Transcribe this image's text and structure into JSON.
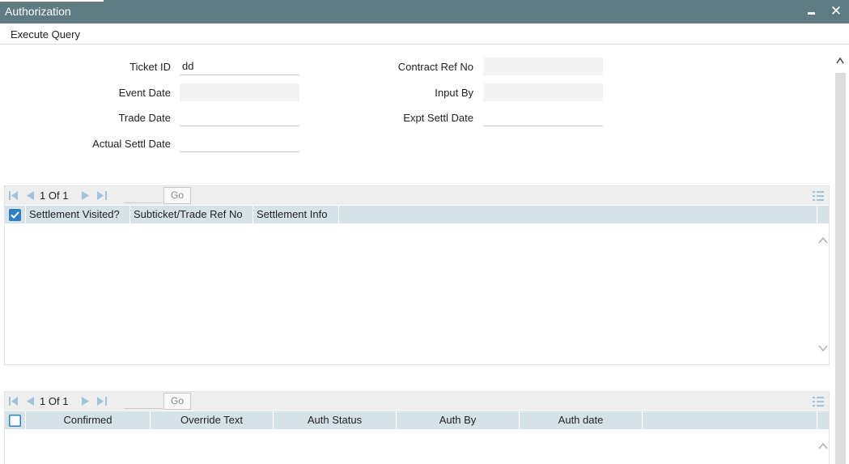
{
  "window": {
    "title": "Authorization",
    "minimize_icon": "minimize-icon",
    "close_icon": "close-icon",
    "title_bar_color": "#5f7c82"
  },
  "toolbar": {
    "execute_query_label": "Execute Query"
  },
  "form": {
    "ticket_id": {
      "label": "Ticket ID",
      "value": "dd"
    },
    "event_date": {
      "label": "Event Date",
      "value": ""
    },
    "trade_date": {
      "label": "Trade Date",
      "value": ""
    },
    "actual_settl_date": {
      "label": "Actual Settl Date",
      "value": ""
    },
    "contract_ref_no": {
      "label": "Contract Ref No",
      "value": ""
    },
    "input_by": {
      "label": "Input By",
      "value": ""
    },
    "expt_settl_date": {
      "label": "Expt Settl Date",
      "value": ""
    }
  },
  "settlement_grid": {
    "page_current": "1",
    "page_of": "Of",
    "page_total": "1",
    "go_label": "Go",
    "header_checkbox_checked": true,
    "columns": [
      "Settlement Visited?",
      "Subticket/Trade Ref No",
      "Settlement Info"
    ],
    "rows": []
  },
  "override_grid": {
    "page_current": "1",
    "page_of": "Of",
    "page_total": "1",
    "go_label": "Go",
    "header_checkbox_checked": false,
    "columns": [
      "Confirmed",
      "Override Text",
      "Auth Status",
      "Auth By",
      "Auth date"
    ],
    "rows": []
  },
  "colors": {
    "header_row": "#d5e3e8",
    "pager_bg": "#eeeeee",
    "pager_icon": "#9ec3dd",
    "checkbox_blue": "#2f7fc4"
  }
}
